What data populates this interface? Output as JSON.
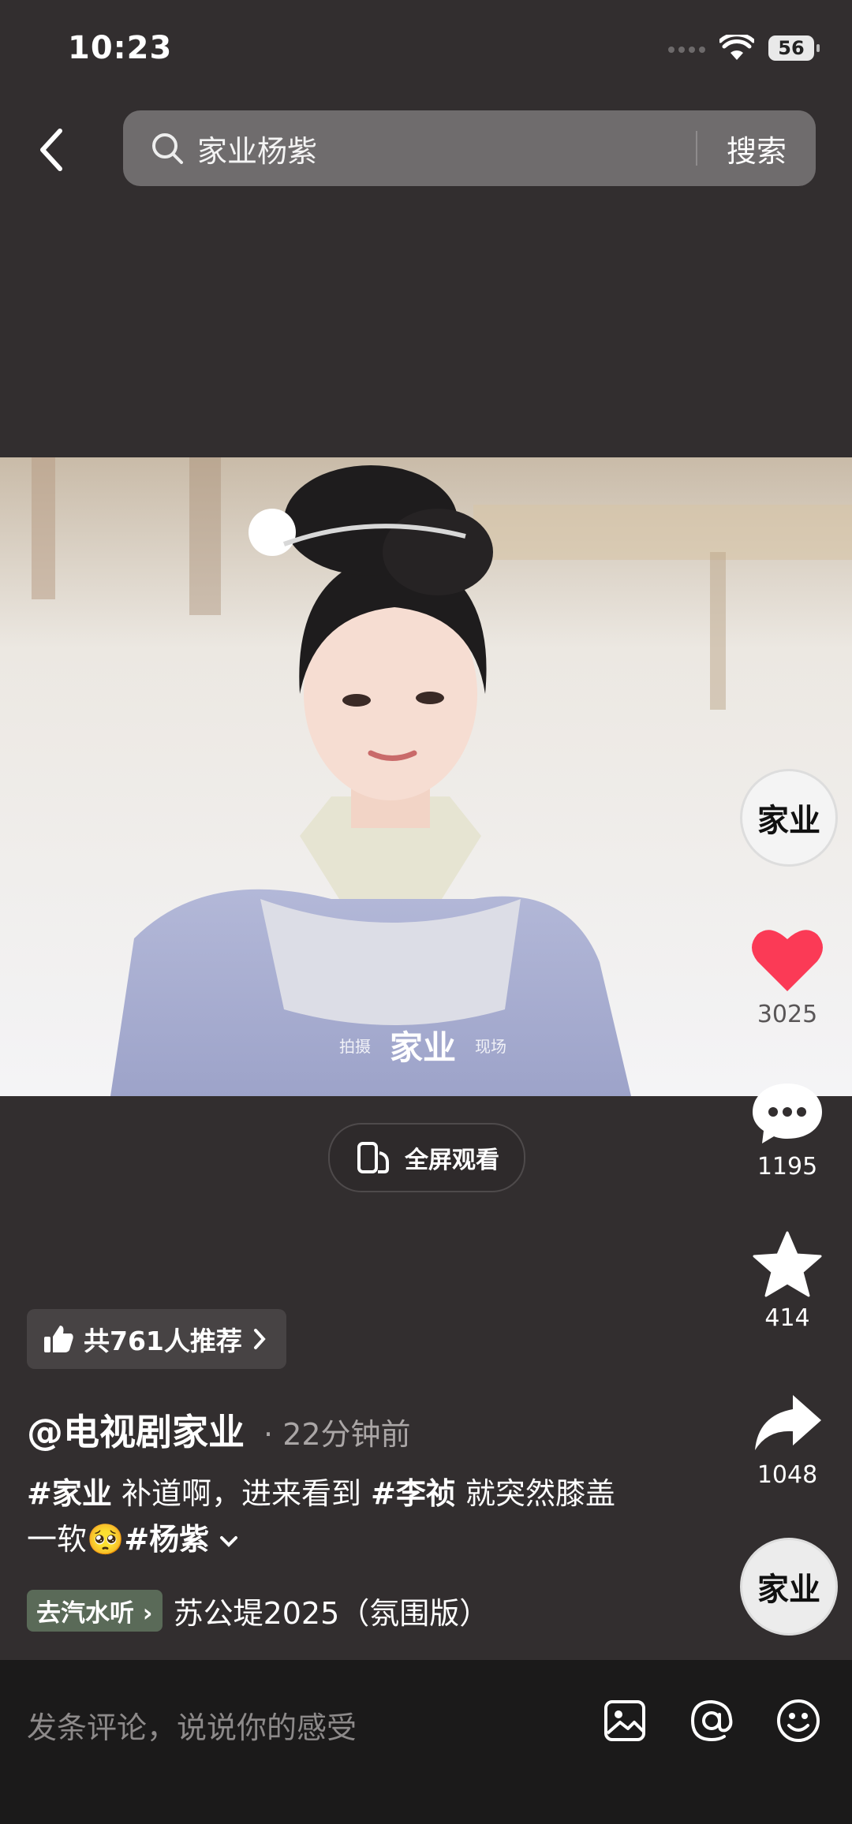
{
  "status_bar": {
    "time": "10:23",
    "battery": "56"
  },
  "search": {
    "query": "家业杨紫",
    "button_label": "搜索"
  },
  "video": {
    "watermark_left": "拍摄",
    "watermark_title": "家业",
    "watermark_right": "现场"
  },
  "fullscreen": {
    "label": "全屏观看"
  },
  "side": {
    "avatar_text": "家业",
    "like_count": "3025",
    "comment_count": "1195",
    "favorite_count": "414",
    "share_count": "1048",
    "music_disc_text": "家业"
  },
  "recommend": {
    "label": "共761人推荐"
  },
  "post": {
    "author": "@电视剧家业",
    "time_ago": "22分钟前",
    "tag1": "#家业",
    "text1": "补道啊，进来看到",
    "tag2": "#李祯",
    "text2": "就突然膝盖一软",
    "emoji": "🥺",
    "tag3": "#杨紫"
  },
  "music": {
    "tag": "去汽水听",
    "title": "苏公堤2025（氛围版）"
  },
  "comment_bar": {
    "placeholder": "发条评论，说说你的感受"
  }
}
